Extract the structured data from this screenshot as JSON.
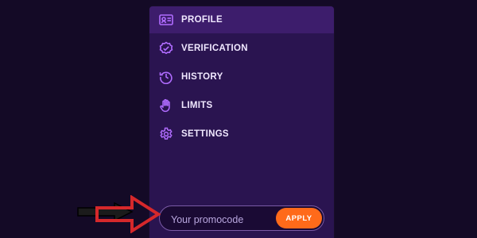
{
  "colors": {
    "background": "#140a26",
    "panel": "#2a1450",
    "active_item": "#3d1d6c",
    "icon": "#b06cff",
    "accent": "#ff6a1a",
    "arrow_red": "#d6282b"
  },
  "menu": {
    "items": [
      {
        "label": "PROFILE",
        "icon": "profile-card-icon",
        "active": true
      },
      {
        "label": "VERIFICATION",
        "icon": "verified-badge-icon",
        "active": false
      },
      {
        "label": "HISTORY",
        "icon": "history-clock-icon",
        "active": false
      },
      {
        "label": "LIMITS",
        "icon": "hand-stop-icon",
        "active": false
      },
      {
        "label": "SETTINGS",
        "icon": "gear-icon",
        "active": false
      }
    ]
  },
  "promo": {
    "placeholder": "Your promocode",
    "apply_label": "APPLY"
  }
}
